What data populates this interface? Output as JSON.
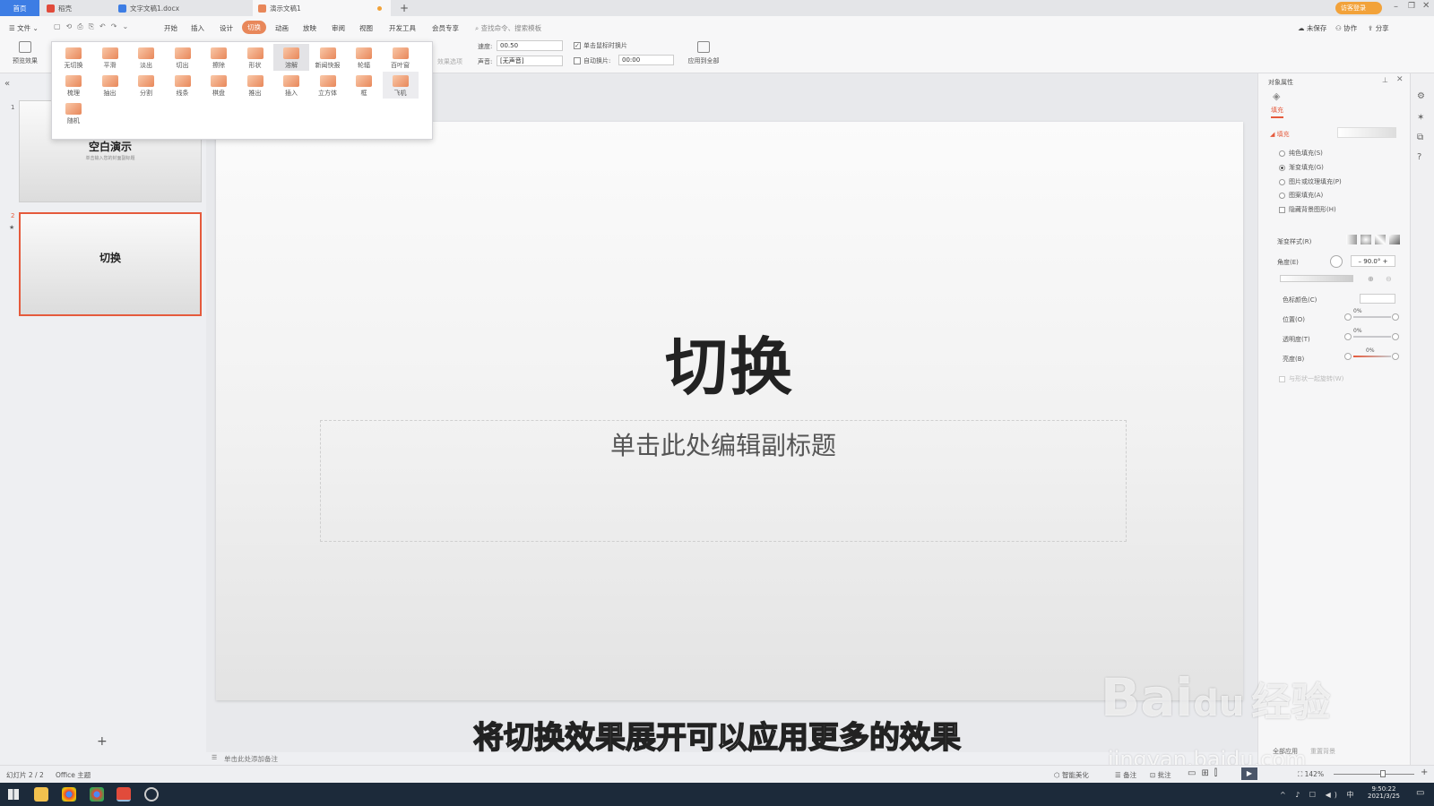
{
  "tabs": {
    "home": "首页",
    "daoke": "稻壳",
    "doc": "文字文稿1.docx",
    "ppt": "演示文稿1"
  },
  "menu": {
    "file": "文件",
    "items": [
      "开始",
      "插入",
      "设计",
      "切换",
      "动画",
      "放映",
      "审阅",
      "视图",
      "开发工具",
      "会员专享"
    ],
    "search": "查找命令、搜索模板",
    "unsaved": "未保存",
    "collab": "协作",
    "share": "分享",
    "login": "访客登录"
  },
  "ribbon": {
    "preview": "预览效果",
    "effect_options": "效果选项",
    "speed_label": "速度:",
    "speed_value": "00.50",
    "sound_label": "声音:",
    "sound_value": "[无声音]",
    "click_label": "单击鼠标时换片",
    "auto_label": "自动换片:",
    "auto_value": "00:00",
    "apply_all": "应用到全部"
  },
  "gallery": {
    "items": [
      "无切换",
      "平滑",
      "淡出",
      "切出",
      "擦除",
      "形状",
      "溶解",
      "新闻快报",
      "轮辐",
      "百叶窗",
      "梳理",
      "抽出",
      "分割",
      "线条",
      "棋盘",
      "推出",
      "插入",
      "立方体",
      "框",
      "飞机",
      "随机"
    ],
    "selected": "溶解",
    "hover": "飞机"
  },
  "slides": [
    {
      "num": "1",
      "title": "空白演示",
      "subtitle": "单击输入您的封面副标题"
    },
    {
      "num": "2",
      "title": "切换"
    }
  ],
  "slide": {
    "title": "切换",
    "subtitle": "单击此处编辑副标题"
  },
  "notes": "单击此处添加备注",
  "props": {
    "title": "对象属性",
    "tab": "填充",
    "section": "填充",
    "fill_options": [
      "纯色填充(S)",
      "渐变填充(G)",
      "图片或纹理填充(P)",
      "图案填充(A)"
    ],
    "hide_bg": "隐藏背景图形(H)",
    "grad_style": "渐变样式(R)",
    "angle_label": "角度(E)",
    "angle_value": "90.0°",
    "stop_color": "色标颜色(C)",
    "position": "位置(O)",
    "position_value": "0%",
    "transparency": "透明度(T)",
    "transparency_value": "0%",
    "brightness": "亮度(B)",
    "brightness_value": "0%",
    "rotate": "与形状一起旋转(W)",
    "apply_all": "全部应用",
    "reset": "重置背景"
  },
  "status": {
    "slide": "幻灯片 2 / 2",
    "theme": "Office 主题",
    "smart": "智能美化",
    "notes": "备注",
    "comment": "批注",
    "zoom": "142%"
  },
  "subtitle_caption": "将切换效果展开可以应用更多的效果",
  "watermark": {
    "brand": "Bai",
    "brand2": "du",
    "jingyan": "经验",
    "url": "jingyan.baidu.com"
  },
  "clock": {
    "time": "9:50:22",
    "date": "2021/3/25"
  },
  "colors": {
    "accent": "#e8875a",
    "tab_active": "#3d7de4",
    "selected_border": "#e55a3c"
  }
}
